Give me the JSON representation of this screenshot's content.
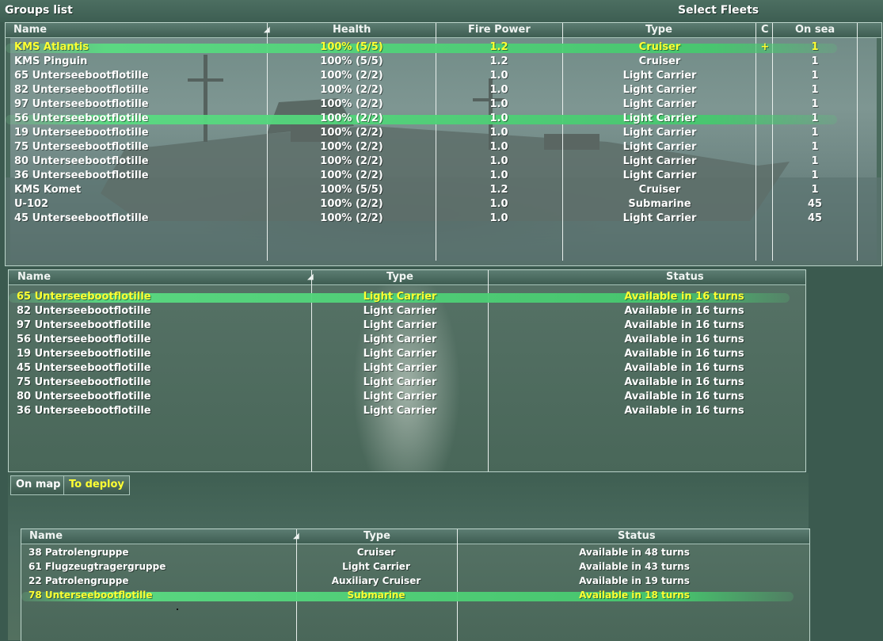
{
  "header": {
    "groups_title": "Groups list",
    "fleets_title": "Select Fleets"
  },
  "groups_table": {
    "columns": {
      "name": "Name",
      "health": "Health",
      "fire_power": "Fire Power",
      "type": "Type",
      "c": "C",
      "on_sea": "On sea"
    },
    "rows": [
      {
        "name": "KMS Atlantis",
        "health": "100% (5/5)",
        "fire_power": "1.2",
        "type": "Cruiser",
        "c": "+",
        "on_sea": "1"
      },
      {
        "name": "KMS Pinguin",
        "health": "100% (5/5)",
        "fire_power": "1.2",
        "type": "Cruiser",
        "c": "",
        "on_sea": "1"
      },
      {
        "name": "65 Unterseebootflotille",
        "health": "100% (2/2)",
        "fire_power": "1.0",
        "type": "Light Carrier",
        "c": "",
        "on_sea": "1"
      },
      {
        "name": "82 Unterseebootflotille",
        "health": "100% (2/2)",
        "fire_power": "1.0",
        "type": "Light Carrier",
        "c": "",
        "on_sea": "1"
      },
      {
        "name": "97 Unterseebootflotille",
        "health": "100% (2/2)",
        "fire_power": "1.0",
        "type": "Light Carrier",
        "c": "",
        "on_sea": "1"
      },
      {
        "name": "56 Unterseebootflotille",
        "health": "100% (2/2)",
        "fire_power": "1.0",
        "type": "Light Carrier",
        "c": "",
        "on_sea": "1"
      },
      {
        "name": "19 Unterseebootflotille",
        "health": "100% (2/2)",
        "fire_power": "1.0",
        "type": "Light Carrier",
        "c": "",
        "on_sea": "1"
      },
      {
        "name": "75 Unterseebootflotille",
        "health": "100% (2/2)",
        "fire_power": "1.0",
        "type": "Light Carrier",
        "c": "",
        "on_sea": "1"
      },
      {
        "name": "80 Unterseebootflotille",
        "health": "100% (2/2)",
        "fire_power": "1.0",
        "type": "Light Carrier",
        "c": "",
        "on_sea": "1"
      },
      {
        "name": "36 Unterseebootflotille",
        "health": "100% (2/2)",
        "fire_power": "1.0",
        "type": "Light Carrier",
        "c": "",
        "on_sea": "1"
      },
      {
        "name": "KMS Komet",
        "health": "100% (5/5)",
        "fire_power": "1.2",
        "type": "Cruiser",
        "c": "",
        "on_sea": "1"
      },
      {
        "name": "U-102",
        "health": "100% (2/2)",
        "fire_power": "1.0",
        "type": "Submarine",
        "c": "",
        "on_sea": "45"
      },
      {
        "name": "45 Unterseebootflotille",
        "health": "100% (2/2)",
        "fire_power": "1.0",
        "type": "Light Carrier",
        "c": "",
        "on_sea": "45"
      }
    ]
  },
  "fleets_table": {
    "columns": {
      "name": "Name",
      "type": "Type",
      "status": "Status"
    },
    "rows": [
      {
        "name": "65 Unterseebootflotille",
        "type": "Light Carrier",
        "status": "Available in 16 turns"
      },
      {
        "name": "82 Unterseebootflotille",
        "type": "Light Carrier",
        "status": "Available in 16 turns"
      },
      {
        "name": "97 Unterseebootflotille",
        "type": "Light Carrier",
        "status": "Available in 16 turns"
      },
      {
        "name": "56 Unterseebootflotille",
        "type": "Light Carrier",
        "status": "Available in 16 turns"
      },
      {
        "name": "19 Unterseebootflotille",
        "type": "Light Carrier",
        "status": "Available in 16 turns"
      },
      {
        "name": "45 Unterseebootflotille",
        "type": "Light Carrier",
        "status": "Available in 16 turns"
      },
      {
        "name": "75 Unterseebootflotille",
        "type": "Light Carrier",
        "status": "Available in 16 turns"
      },
      {
        "name": "80 Unterseebootflotille",
        "type": "Light Carrier",
        "status": "Available in 16 turns"
      },
      {
        "name": "36 Unterseebootflotille",
        "type": "Light Carrier",
        "status": "Available in 16 turns"
      }
    ]
  },
  "tabs": {
    "on_map": "On map",
    "to_deploy": "To deploy"
  },
  "deploy_table": {
    "columns": {
      "name": "Name",
      "type": "Type",
      "status": "Status"
    },
    "rows": [
      {
        "name": "38 Patrolengruppe",
        "type": "Cruiser",
        "status": "Available in 48 turns"
      },
      {
        "name": "61 Flugzeugtragergruppe",
        "type": "Light Carrier",
        "status": "Available in 43 turns"
      },
      {
        "name": "22 Patrolengruppe",
        "type": "Auxiliary Cruiser",
        "status": "Available in 19 turns"
      },
      {
        "name": "78 Unterseebootflotille",
        "type": "Submarine",
        "status": "Available in 18 turns"
      }
    ]
  },
  "colors": {
    "selected_text": "#ffff33",
    "selection_bar": "#4fd67e",
    "panel_bg": "#4b6a5c",
    "text": "#ffffff"
  }
}
